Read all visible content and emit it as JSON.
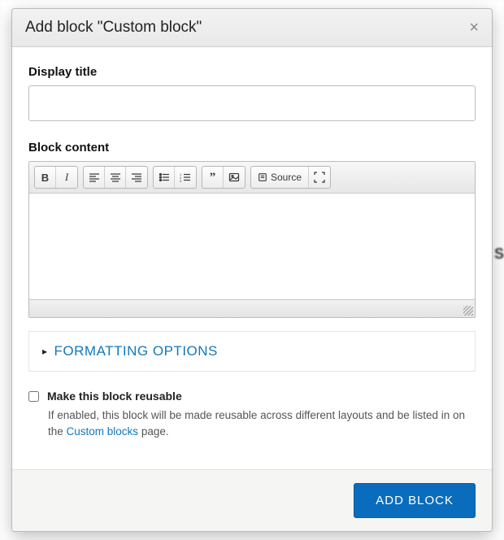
{
  "modal": {
    "title": "Add block \"Custom block\"",
    "close_glyph": "×"
  },
  "form": {
    "display_title_label": "Display title",
    "display_title_value": "",
    "block_content_label": "Block content"
  },
  "editor": {
    "toolbar": {
      "bold": "B",
      "italic": "I",
      "align_left": "align-left",
      "align_center": "align-center",
      "align_right": "align-right",
      "ul": "bulleted-list",
      "ol": "numbered-list",
      "blockquote": "”",
      "image": "image",
      "source_label": "Source",
      "maximize": "maximize"
    },
    "content": ""
  },
  "details": {
    "formatting_label": "FORMATTING OPTIONS",
    "expanded": false
  },
  "reusable": {
    "label": "Make this block reusable",
    "checked": false,
    "help_pre": "If enabled, this block will be made reusable across different layouts and be listed in on the ",
    "help_link": "Custom blocks",
    "help_post": " page."
  },
  "footer": {
    "submit_label": "ADD BLOCK"
  }
}
